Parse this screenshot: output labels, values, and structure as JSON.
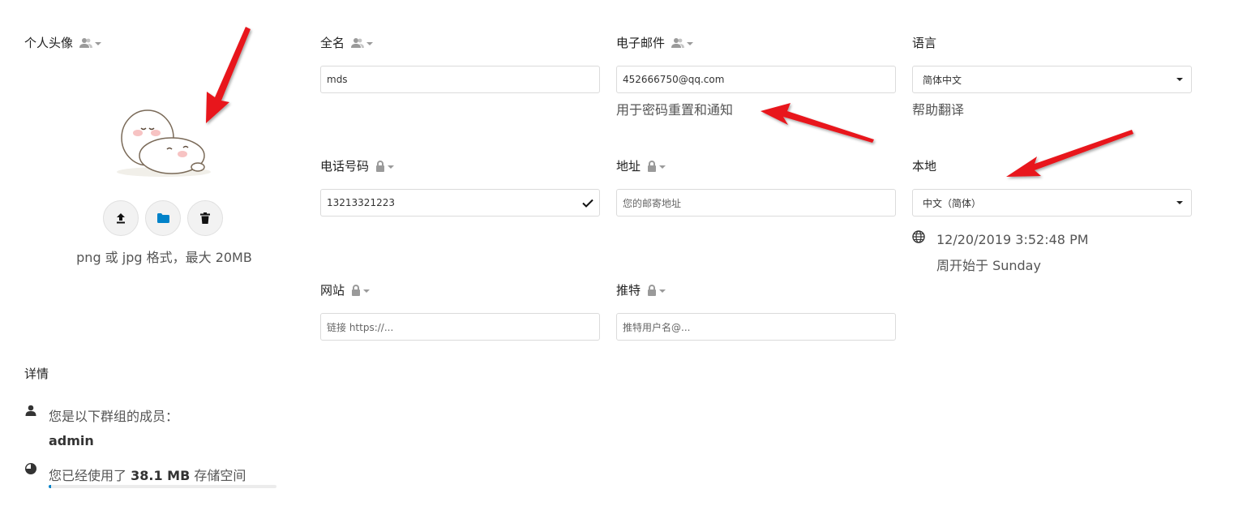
{
  "avatar": {
    "label": "个人头像",
    "hint": "png 或 jpg 格式，最大 20MB",
    "buttons": [
      "upload-icon",
      "folder-icon",
      "trash-icon"
    ]
  },
  "fullname": {
    "label": "全名",
    "value": "mds"
  },
  "email": {
    "label": "电子邮件",
    "value": "452666750@qq.com",
    "hint": "用于密码重置和通知"
  },
  "language": {
    "label": "语言",
    "selected": "简体中文",
    "hint": "帮助翻译"
  },
  "phone": {
    "label": "电话号码",
    "value": "13213321223"
  },
  "address": {
    "label": "地址",
    "placeholder": "您的邮寄地址"
  },
  "locale": {
    "label": "本地",
    "selected": "中文（简体）",
    "datetime": "12/20/2019 3:52:48 PM",
    "week_start": "周开始于 Sunday"
  },
  "website": {
    "label": "网站",
    "placeholder": "链接 https://..."
  },
  "twitter": {
    "label": "推特",
    "placeholder": "推特用户名@..."
  },
  "details": {
    "heading": "详情",
    "groups_text": "您是以下群组的成员：",
    "group_name": "admin",
    "usage_prefix": "您已经使用了",
    "usage_amount": "38.1 MB",
    "usage_suffix": "存储空间",
    "usage_fraction": 0.01
  },
  "colors": {
    "accent": "#0082c9",
    "arrow": "#e8161b"
  }
}
